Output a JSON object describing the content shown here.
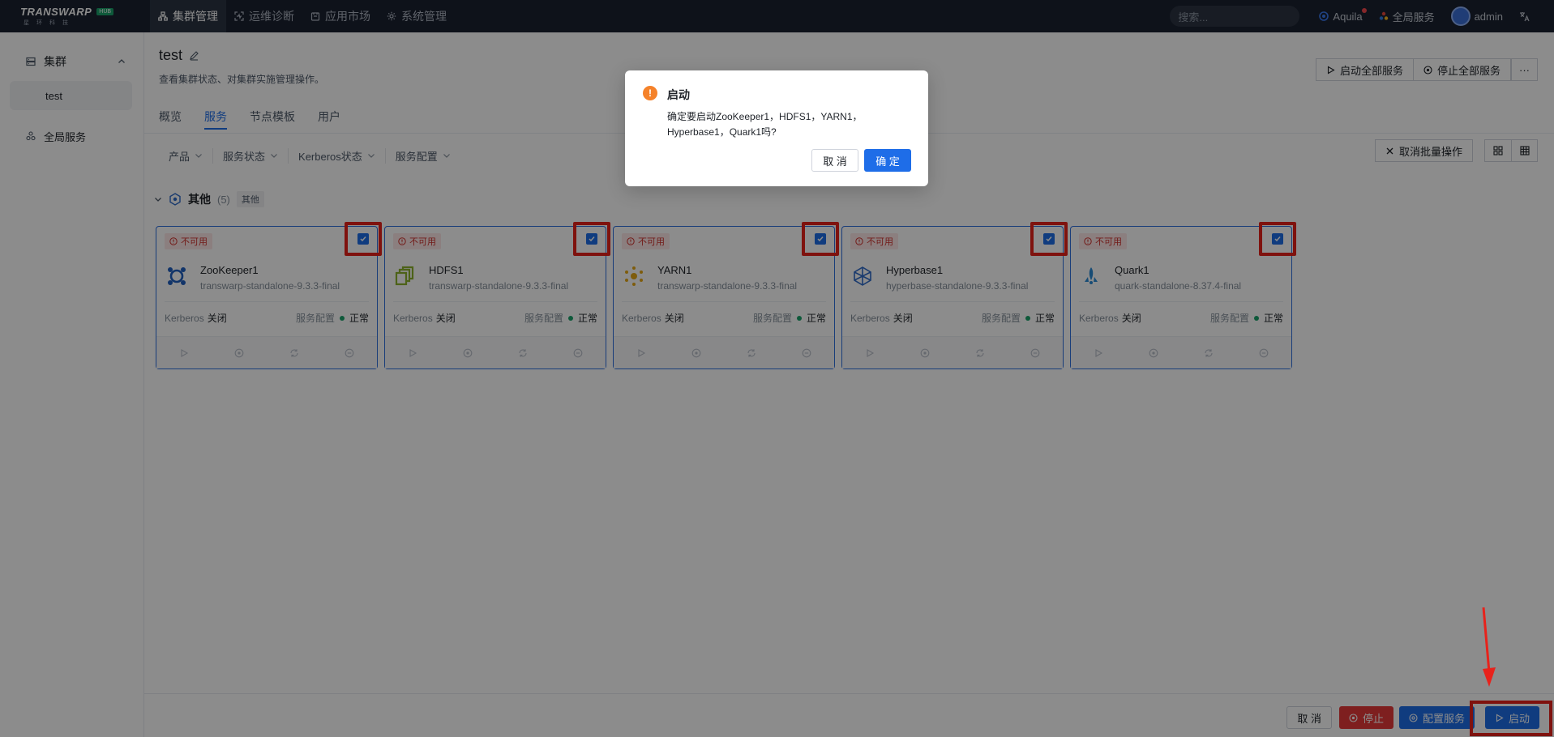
{
  "brand": {
    "name": "TRANSWARP",
    "badge": "HUB",
    "sub": "星环科技"
  },
  "topnav": {
    "items": [
      {
        "label": "集群管理",
        "icon": "cluster-icon"
      },
      {
        "label": "运维诊断",
        "icon": "diagnosis-icon"
      },
      {
        "label": "应用市场",
        "icon": "market-icon"
      },
      {
        "label": "系统管理",
        "icon": "gear-icon"
      }
    ],
    "search_placeholder": "搜索...",
    "aquila": "Aquila",
    "global_service": "全局服务",
    "user": "admin"
  },
  "sidebar": {
    "group": "集群",
    "cluster_item": "test",
    "global_service": "全局服务"
  },
  "page": {
    "title": "test",
    "desc": "查看集群状态、对集群实施管理操作。",
    "start_all": "启动全部服务",
    "stop_all": "停止全部服务",
    "more": "···"
  },
  "tabs": [
    "概览",
    "服务",
    "节点模板",
    "用户"
  ],
  "filters": [
    "产品",
    "服务状态",
    "Kerberos状态",
    "服务配置"
  ],
  "cancel_batch": "取消批量操作",
  "section": {
    "title": "其他",
    "count": "(5)",
    "tag": "其他"
  },
  "cards": [
    {
      "status": "不可用",
      "name": "ZooKeeper1",
      "version": "transwarp-standalone-9.3.3-final",
      "kerberos_label": "Kerberos",
      "kerberos_value": "关闭",
      "config_label": "服务配置",
      "config_value": "正常",
      "icon": "zookeeper-icon",
      "color": "#1f5fbf"
    },
    {
      "status": "不可用",
      "name": "HDFS1",
      "version": "transwarp-standalone-9.3.3-final",
      "kerberos_label": "Kerberos",
      "kerberos_value": "关闭",
      "config_label": "服务配置",
      "config_value": "正常",
      "icon": "hdfs-icon",
      "color": "#8cb22c"
    },
    {
      "status": "不可用",
      "name": "YARN1",
      "version": "transwarp-standalone-9.3.3-final",
      "kerberos_label": "Kerberos",
      "kerberos_value": "关闭",
      "config_label": "服务配置",
      "config_value": "正常",
      "icon": "yarn-icon",
      "color": "#e6a817"
    },
    {
      "status": "不可用",
      "name": "Hyperbase1",
      "version": "hyperbase-standalone-9.3.3-final",
      "kerberos_label": "Kerberos",
      "kerberos_value": "关闭",
      "config_label": "服务配置",
      "config_value": "正常",
      "icon": "hyperbase-icon",
      "color": "#2e6ac8"
    },
    {
      "status": "不可用",
      "name": "Quark1",
      "version": "quark-standalone-8.37.4-final",
      "kerberos_label": "Kerberos",
      "kerberos_value": "关闭",
      "config_label": "服务配置",
      "config_value": "正常",
      "icon": "quark-icon",
      "color": "#2a8ad6"
    }
  ],
  "bottom_bar": {
    "cancel": "取 消",
    "stop": "停止",
    "config": "配置服务",
    "start": "启动"
  },
  "modal": {
    "title": "启动",
    "body": "确定要启动ZooKeeper1，HDFS1，YARN1，Hyperbase1，Quark1吗?",
    "cancel": "取 消",
    "ok": "确 定"
  },
  "colors": {
    "primary": "#1e6de8",
    "danger": "#e5393a",
    "warning": "#f5822a",
    "annotation": "#e8221b",
    "success": "#1aa36b"
  }
}
